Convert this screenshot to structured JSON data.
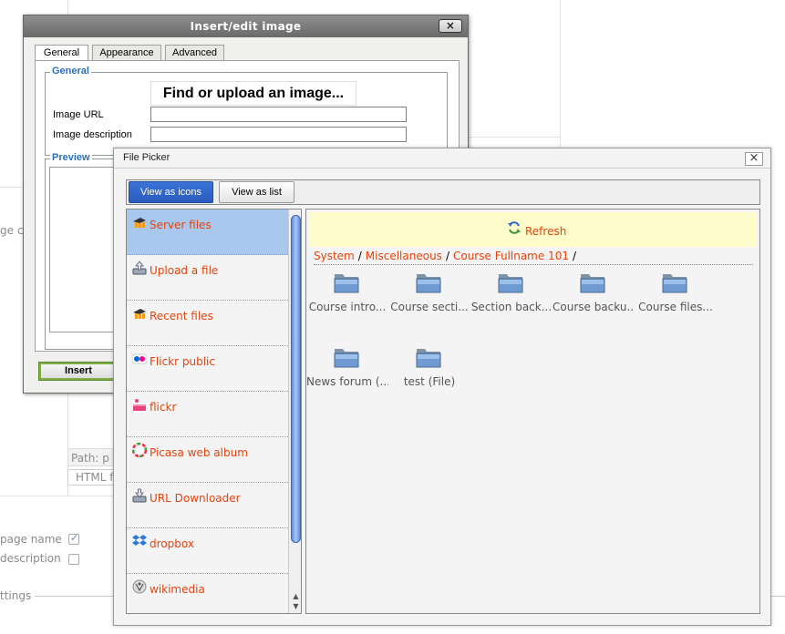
{
  "background": {
    "path_label": "Path: p",
    "html_button": "HTML f",
    "cut_label_1": "ge co",
    "page_name_label": "page name",
    "description_label": "description",
    "settings_legend": "ttings",
    "page_name_checked": true,
    "description_checked": false
  },
  "image_dialog": {
    "title": "Insert/edit image",
    "close_label": "×",
    "tabs": [
      {
        "label": "General",
        "active": true
      },
      {
        "label": "Appearance",
        "active": false
      },
      {
        "label": "Advanced",
        "active": false
      }
    ],
    "general_legend": "General",
    "find_button": "Find or upload an image...",
    "image_url_label": "Image URL",
    "image_url_value": "",
    "image_description_label": "Image description",
    "image_description_value": "",
    "preview_legend": "Preview",
    "insert_button": "Insert"
  },
  "file_picker": {
    "title": "File Picker",
    "close_label": "×",
    "view_icons": "View as icons",
    "view_list": "View as list",
    "repositories": [
      {
        "label": "Server files",
        "icon": "moodle-icon",
        "selected": true
      },
      {
        "label": "Upload a file",
        "icon": "upload-icon",
        "selected": false
      },
      {
        "label": "Recent files",
        "icon": "moodle-icon",
        "selected": false
      },
      {
        "label": "Flickr public",
        "icon": "flickr-icon",
        "selected": false
      },
      {
        "label": "flickr",
        "icon": "flickr-icon",
        "selected": false
      },
      {
        "label": "Picasa web album",
        "icon": "picasa-icon",
        "selected": false
      },
      {
        "label": "URL Downloader",
        "icon": "download-icon",
        "selected": false
      },
      {
        "label": "dropbox",
        "icon": "dropbox-icon",
        "selected": false
      },
      {
        "label": "wikimedia",
        "icon": "wikimedia-icon",
        "selected": false
      }
    ],
    "refresh_label": "Refresh",
    "breadcrumb": [
      "System",
      "Miscellaneous",
      "Course Fullname 101"
    ],
    "breadcrumb_sep": "/",
    "files": [
      {
        "name": "Course intro..."
      },
      {
        "name": "Course secti..."
      },
      {
        "name": "Section back..."
      },
      {
        "name": "Course backu..."
      },
      {
        "name": "Course files..."
      },
      {
        "name": "News forum (..."
      },
      {
        "name": "test (File)"
      }
    ],
    "colors": {
      "accent": "#e8420a",
      "selected": "#a8c8ee",
      "refresh_bg": "#fffccc",
      "button_blue": "#2a5cc0"
    }
  }
}
